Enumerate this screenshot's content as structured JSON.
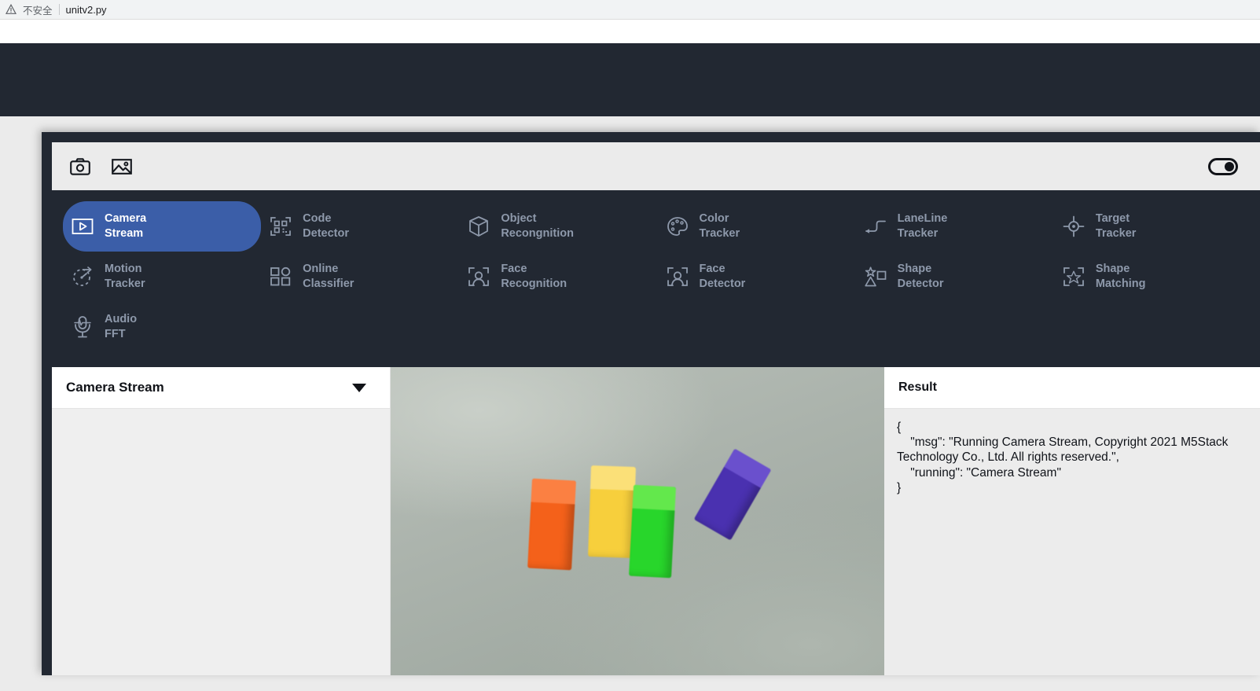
{
  "browser": {
    "warn_icon": "warning-triangle-icon",
    "insecure_label": "不安全",
    "url": "unitv2.py"
  },
  "toolbar": {
    "icons": [
      {
        "name": "camera-icon",
        "label": "Camera"
      },
      {
        "name": "image-icon",
        "label": "Image"
      }
    ],
    "toggle": {
      "name": "power-toggle",
      "state": "on"
    }
  },
  "colors": {
    "accent_blue": "#3b5ea8",
    "dark_panel": "#222832",
    "menu_label": "#8e99ab",
    "page_bg": "#ebebeb"
  },
  "function_menu": {
    "items": [
      {
        "icon": "video-play-icon",
        "line1": "Camera",
        "line2": "Stream",
        "active": true
      },
      {
        "icon": "qrcode-icon",
        "line1": "Code",
        "line2": "Detector",
        "active": false
      },
      {
        "icon": "cube-icon",
        "line1": "Object",
        "line2": "Recongnition",
        "active": false
      },
      {
        "icon": "palette-icon",
        "line1": "Color",
        "line2": "Tracker",
        "active": false
      },
      {
        "icon": "laneline-icon",
        "line1": "LaneLine",
        "line2": "Tracker",
        "active": false
      },
      {
        "icon": "target-crosshair-icon",
        "line1": "Target",
        "line2": "Tracker",
        "active": false
      },
      {
        "icon": "motion-icon",
        "line1": "Motion",
        "line2": "Tracker",
        "active": false
      },
      {
        "icon": "grid-shapes-icon",
        "line1": "Online",
        "line2": "Classifier",
        "active": false
      },
      {
        "icon": "face-scan-icon",
        "line1": "Face",
        "line2": "Recognition",
        "active": false
      },
      {
        "icon": "face-scan-icon",
        "line1": "Face",
        "line2": "Detector",
        "active": false
      },
      {
        "icon": "shape-detector-icon",
        "line1": "Shape",
        "line2": "Detector",
        "active": false
      },
      {
        "icon": "shape-matching-icon",
        "line1": "Shape",
        "line2": "Matching",
        "active": false
      },
      {
        "icon": "microphone-icon",
        "line1": "Audio",
        "line2": "FFT",
        "active": false
      }
    ]
  },
  "left_panel": {
    "title": "Camera Stream",
    "caret_icon": "chevron-down-icon"
  },
  "video": {
    "name": "camera-stream-preview",
    "blocks": [
      {
        "name": "orange-block",
        "color": "#f4611a",
        "top_color": "#fb8042"
      },
      {
        "name": "yellow-block",
        "color": "#f7cf3c",
        "top_color": "#fbdf70"
      },
      {
        "name": "green-block",
        "color": "#28d62b",
        "top_color": "#62e84a"
      },
      {
        "name": "purple-block",
        "color": "#4a31b0",
        "top_color": "#6b4fd0"
      }
    ]
  },
  "result_panel": {
    "title": "Result",
    "json_text": "{\n    \"msg\": \"Running Camera Stream, Copyright 2021 M5Stack Technology Co., Ltd. All rights reserved.\",\n    \"running\": \"Camera Stream\"\n}"
  }
}
